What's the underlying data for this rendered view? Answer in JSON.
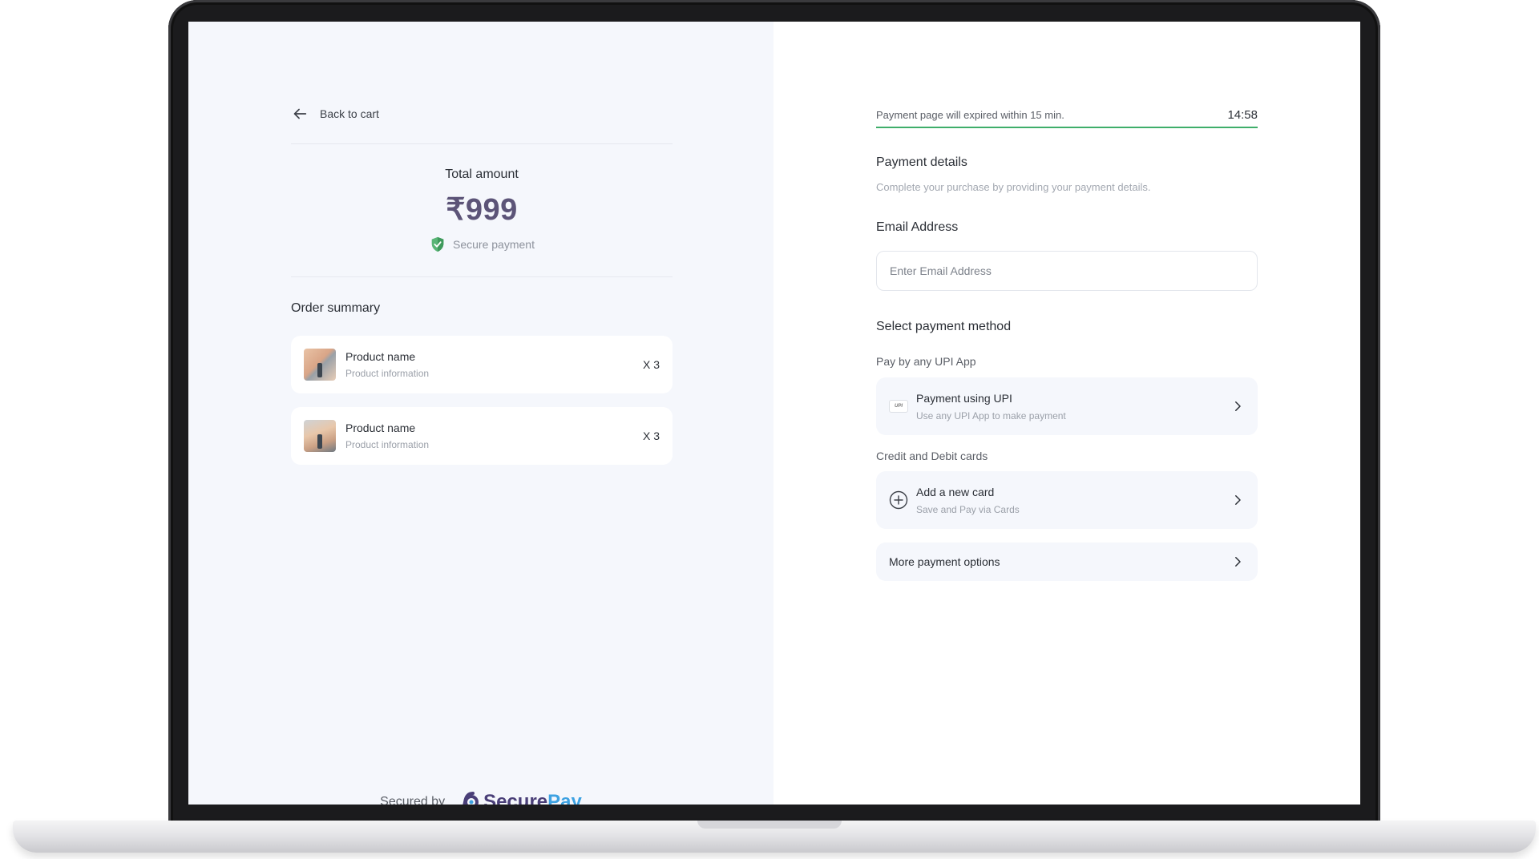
{
  "left": {
    "back_label": "Back to cart",
    "total_label": "Total amount",
    "total_value": "₹999",
    "secure_label": "Secure payment",
    "order_summary_title": "Order summary",
    "products": [
      {
        "name": "Product name",
        "info": "Product information",
        "qty": "X 3"
      },
      {
        "name": "Product name",
        "info": "Product information",
        "qty": "X 3"
      }
    ],
    "secured_by": "Secured by",
    "brand_part1": "Secure",
    "brand_part2": "Pay"
  },
  "right": {
    "timer_text": "Payment page will expired within 15 min.",
    "timer_value": "14:58",
    "details_title": "Payment details",
    "details_sub": "Complete your purchase by providing your payment details.",
    "email_label": "Email Address",
    "email_placeholder": "Enter Email Address",
    "email_value": "",
    "method_title": "Select payment method",
    "upi_group_label": "Pay by any UPI App",
    "upi_option": {
      "title": "Payment using UPI",
      "sub": "Use any UPI App to make payment",
      "badge": "UPI"
    },
    "cards_group_label": "Credit and Debit cards",
    "card_option": {
      "title": "Add a new card",
      "sub": "Save and Pay via Cards"
    },
    "more_option": {
      "title": "More payment options"
    }
  },
  "colors": {
    "accent_green": "#3fae6a",
    "amount_purple": "#5c5478",
    "brand_purple": "#4a3f78",
    "brand_blue": "#3ea2e2",
    "panel_bg": "#f5f7fc"
  }
}
